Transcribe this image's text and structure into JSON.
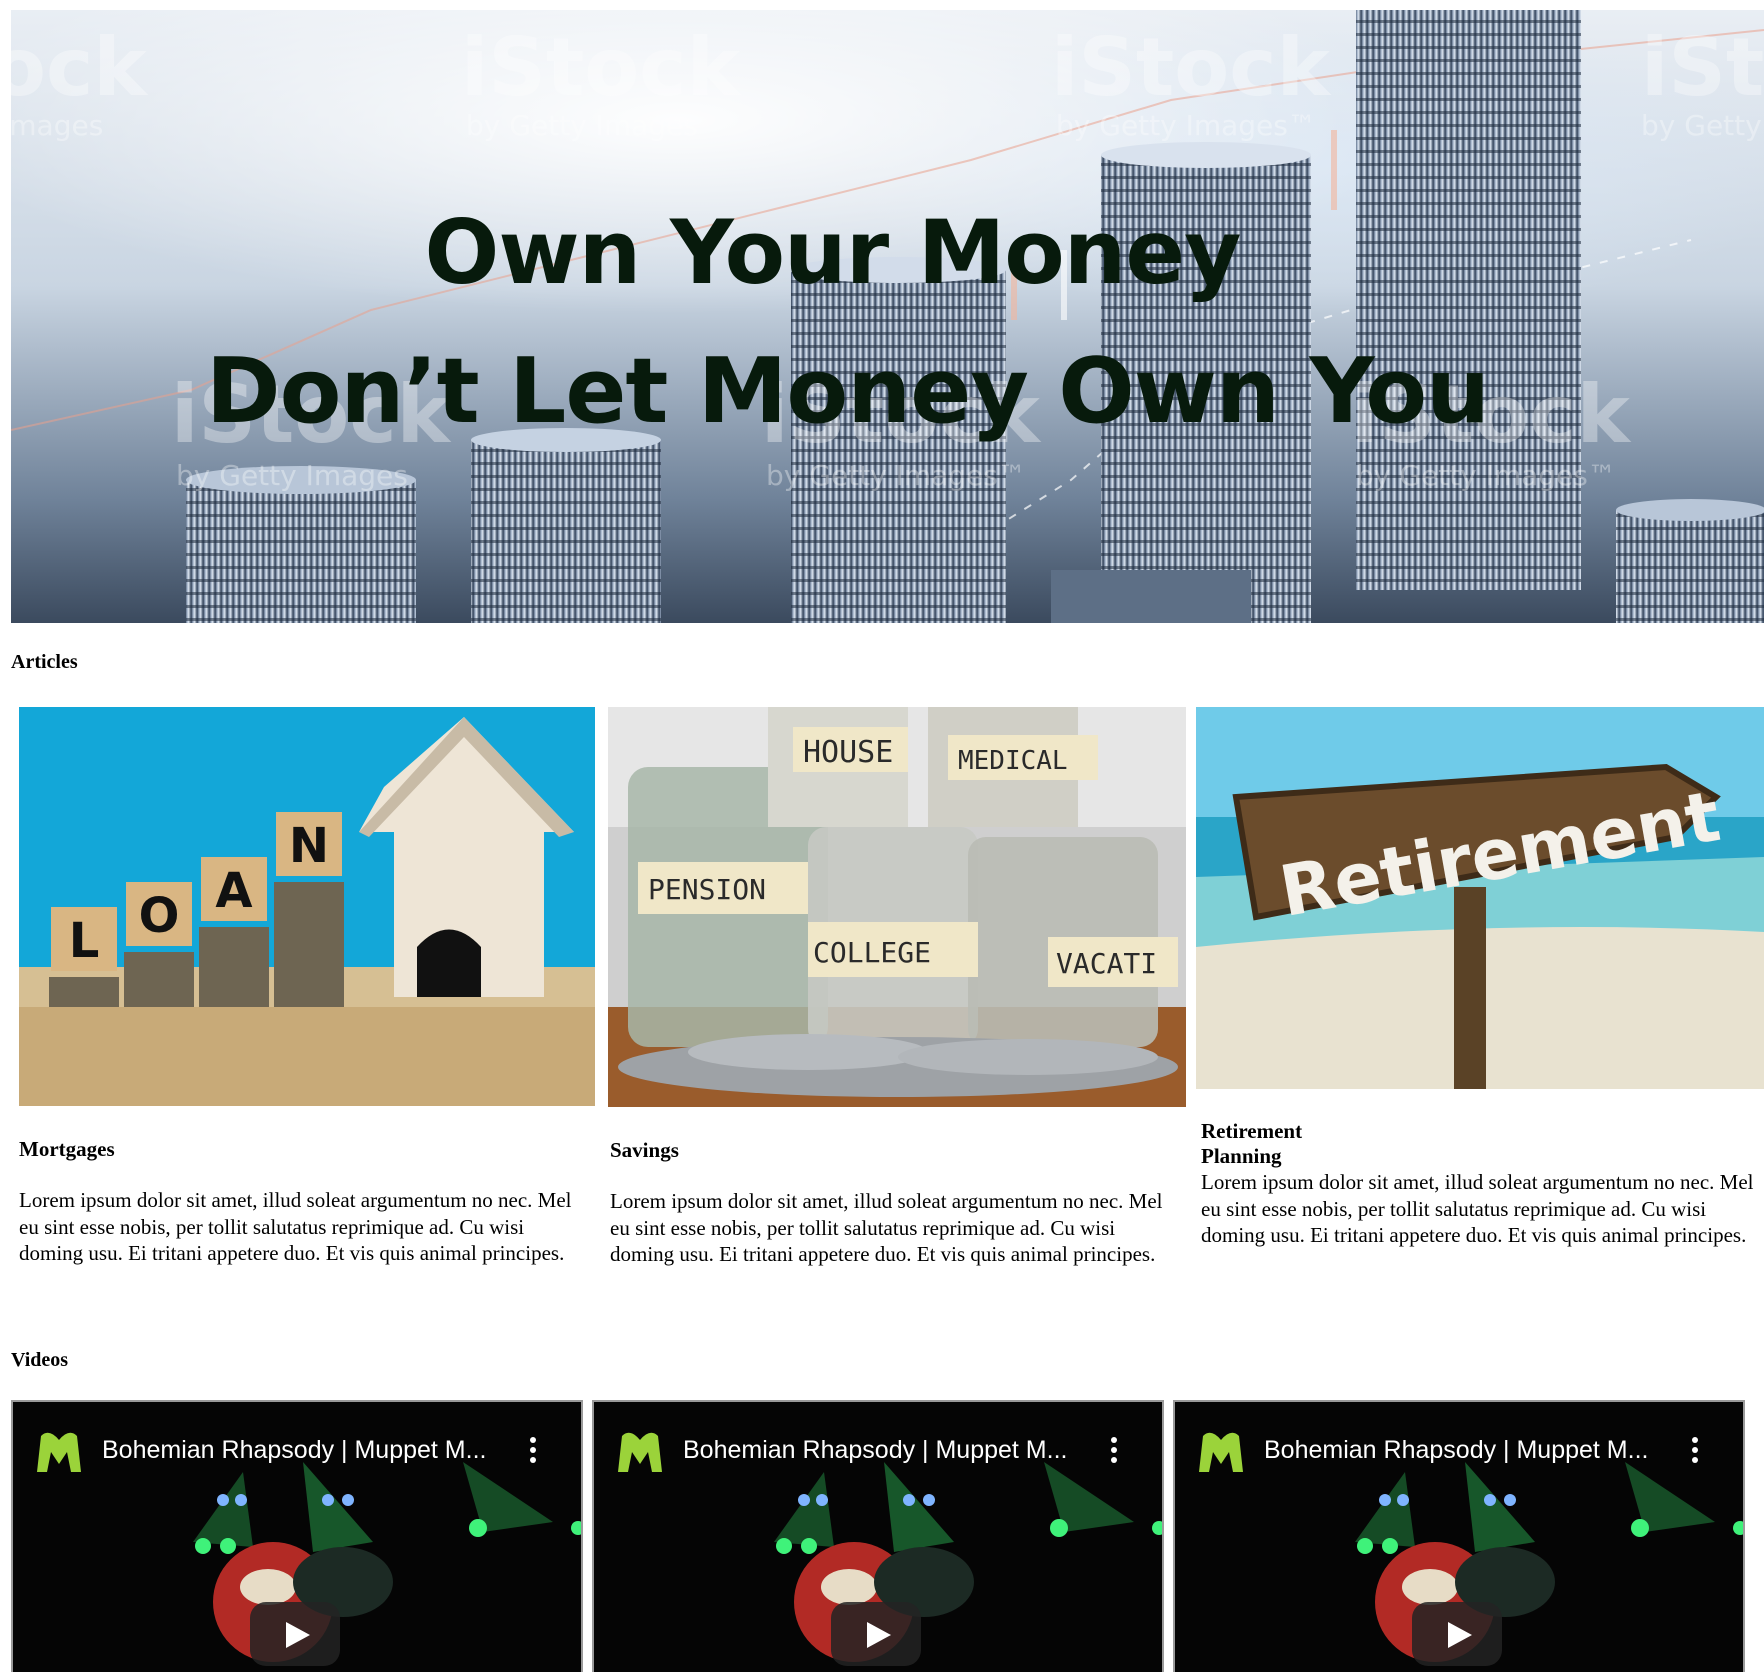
{
  "hero": {
    "title_line1": "Own Your Money",
    "title_line2": "Don’t Let Money Own You",
    "watermark_brand": "iStock",
    "watermark_sub": "by Getty Images™"
  },
  "articles_heading": "Articles",
  "articles": [
    {
      "title": "Mortgages",
      "body": "Lorem ipsum dolor sit amet, illud soleat argumentum no nec. Mel eu sint esse nobis, per tollit salutatus reprimique ad. Cu wisi doming usu. Ei tritani appetere duo. Et vis quis animal principes.",
      "image_letters": [
        "L",
        "O",
        "A",
        "N"
      ]
    },
    {
      "title": "Savings",
      "body": "Lorem ipsum dolor sit amet, illud soleat argumentum no nec. Mel eu sint esse nobis, per tollit salutatus reprimique ad. Cu wisi doming usu. Ei tritani appetere duo. Et vis quis animal principes.",
      "image_labels": [
        "HOUSE",
        "MEDICAL",
        "PENSION",
        "COLLEGE",
        "VACATI"
      ]
    },
    {
      "title": "Retirement Planning",
      "body": "Lorem ipsum dolor sit amet, illud soleat argumentum no nec. Mel eu sint esse nobis, per tollit salutatus reprimique ad. Cu wisi doming usu. Ei tritani appetere duo. Et vis quis animal principes.",
      "image_sign": "Retirement"
    }
  ],
  "videos_heading": "Videos",
  "videos": [
    {
      "title": "Bohemian Rhapsody | Muppet M..."
    },
    {
      "title": "Bohemian Rhapsody | Muppet M..."
    },
    {
      "title": "Bohemian Rhapsody | Muppet M..."
    }
  ],
  "colors": {
    "hero_title": "#071a0c",
    "video_bg": "#000000",
    "channel_logo": "#9bd33a"
  }
}
